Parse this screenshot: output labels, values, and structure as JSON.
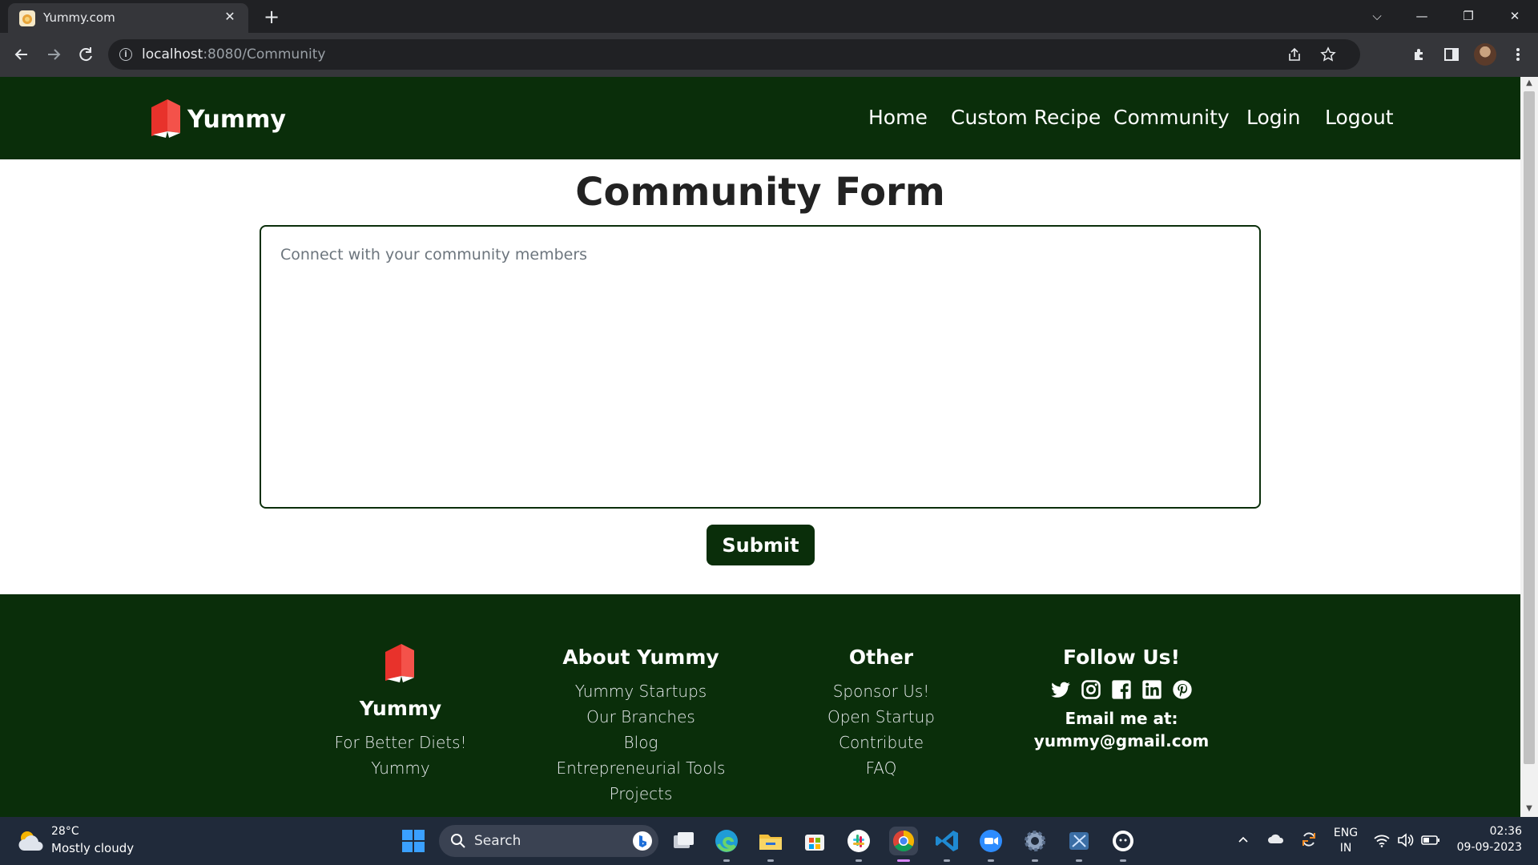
{
  "browser": {
    "tab_title": "Yummy.com",
    "tab_close": "✕",
    "new_tab": "+",
    "url_host": "localhost",
    "url_rest": ":8080/Community",
    "window_controls": {
      "dropdown": "⌵",
      "minimize": "—",
      "restore": "❐",
      "close": "✕"
    }
  },
  "site": {
    "brand": "Yummy",
    "brand_color": "#0a2e0a",
    "logo_color": "#e8322b",
    "nav": [
      {
        "label": "Home"
      },
      {
        "label": "Custom Recipe"
      },
      {
        "label": "Community"
      },
      {
        "label": "Login"
      },
      {
        "label": "Logout"
      }
    ]
  },
  "form": {
    "title": "Community Form",
    "placeholder": "Connect with your community members",
    "submit_label": "Submit"
  },
  "footer": {
    "brand": "Yummy",
    "tagline": "For Better Diets! Yummy",
    "about_heading": "About Yummy",
    "about_links": [
      "Yummy Startups",
      "Our Branches",
      "Blog",
      "Entrepreneurial Tools",
      "Projects"
    ],
    "other_heading": "Other",
    "other_links": [
      "Sponsor Us!",
      "Open Startup",
      "Contribute",
      "FAQ"
    ],
    "follow_heading": "Follow Us!",
    "social_icons": [
      "twitter-icon",
      "instagram-icon",
      "facebook-icon",
      "linkedin-icon",
      "pinterest-icon"
    ],
    "email_label": "Email me at:",
    "email": "yummy@gmail.com"
  },
  "taskbar": {
    "temperature": "28°C",
    "weather": "Mostly cloudy",
    "search_label": "Search",
    "lang_1": "ENG",
    "lang_2": "IN",
    "time": "02:36",
    "date": "09-09-2023"
  }
}
